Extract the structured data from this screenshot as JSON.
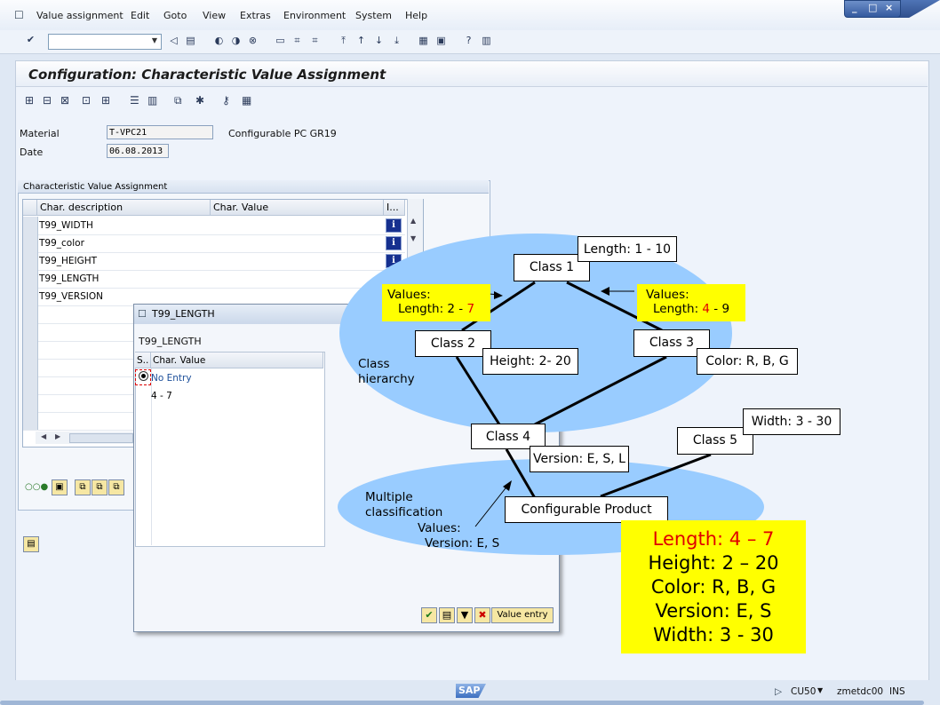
{
  "menu": {
    "items": [
      "Value assignment",
      "Edit",
      "Goto",
      "View",
      "Extras",
      "Environment",
      "System",
      "Help"
    ]
  },
  "toolbar": {
    "command_value": ""
  },
  "screen": {
    "title": "Configuration: Characteristic Value Assignment"
  },
  "header_fields": {
    "material_label": "Material",
    "material_value": "T-VPC21",
    "material_desc": "Configurable PC GR19",
    "date_label": "Date",
    "date_value": "06.08.2013"
  },
  "char_table": {
    "group_title": "Characteristic Value Assignment",
    "columns": [
      "Char. description",
      "Char. Value",
      "I..."
    ],
    "rows": [
      {
        "desc": "T99_WIDTH",
        "value": ""
      },
      {
        "desc": "T99_color",
        "value": ""
      },
      {
        "desc": "T99_HEIGHT",
        "value": ""
      },
      {
        "desc": "T99_LENGTH",
        "value": ""
      },
      {
        "desc": "T99_VERSION",
        "value": ""
      }
    ]
  },
  "popup": {
    "title": "T99_LENGTH",
    "subtitle": "T99_LENGTH",
    "col_s": "S..",
    "col_value": "Char. Value",
    "options": [
      "No Entry",
      "4 - 7"
    ],
    "value_entry_label": "Value entry"
  },
  "diagram": {
    "class1": "Class 1",
    "class2": "Class 2",
    "class3": "Class 3",
    "class4": "Class 4",
    "class5": "Class 5",
    "product": "Configurable Product",
    "length_box": "Length: 1 - 10",
    "height_box": "Height: 2- 20",
    "color_box": "Color: R, B, G",
    "width_box": "Width: 3 - 30",
    "version_box": "Version: E, S, L",
    "values_left_1": "Values:",
    "values_left_2a": "Length: 2 - ",
    "values_left_2b": "7",
    "values_right_1": "Values:",
    "values_right_2a": "Length: ",
    "values_right_2b": "4",
    "values_right_2c": " - 9",
    "class_hierarchy_1": "Class",
    "class_hierarchy_2": "hierarchy",
    "multiple_1": "Multiple",
    "multiple_2": "classification",
    "values_bottom_1": "Values:",
    "values_bottom_2": "Version: E, S",
    "summary": [
      "Length: 4 – 7",
      "Height: 2 – 20",
      "Color: R, B, G",
      "Version: E, S",
      "Width: 3 - 30"
    ]
  },
  "statusbar": {
    "logo": "SAP",
    "tcode": "CU50",
    "server": "zmetdc00",
    "mode": "INS"
  }
}
